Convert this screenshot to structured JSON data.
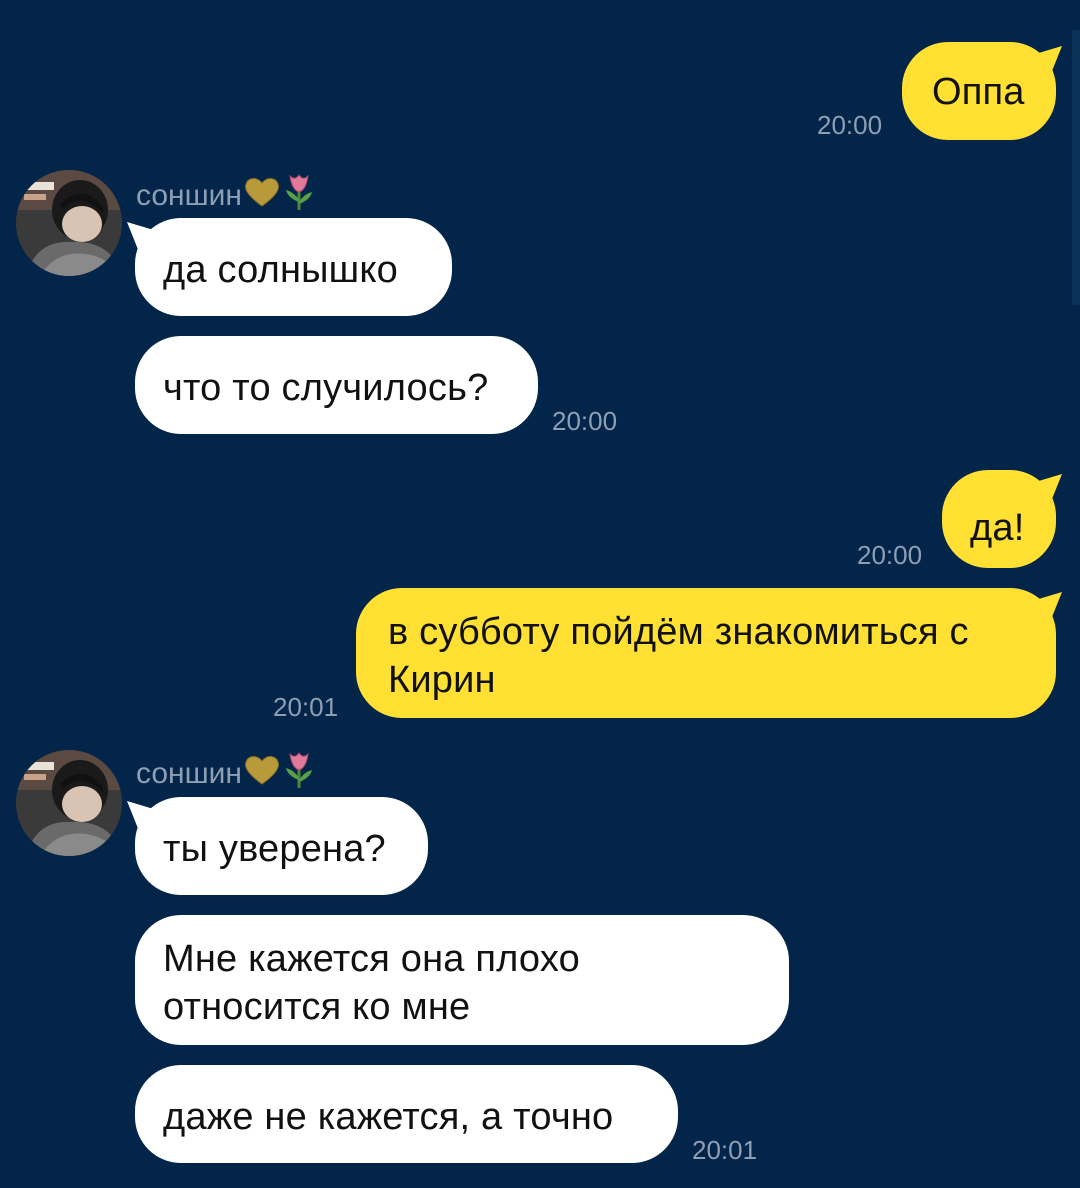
{
  "messages": [
    {
      "text": "Оппа",
      "time": "20:00"
    },
    {
      "sender": "соншин",
      "text": "да солнышко"
    },
    {
      "text": "что то случилось?",
      "time": "20:00"
    },
    {
      "text": "да!",
      "time": "20:00"
    },
    {
      "text_line1": "в субботу пойдём знакомиться с",
      "text_line2": "Кирин",
      "time": "20:01"
    },
    {
      "sender": "соншин",
      "text": "ты уверена?"
    },
    {
      "text_line1": "Мне кажется она плохо",
      "text_line2": "относится ко мне"
    },
    {
      "text": "даже не кажется, а точно",
      "time": "20:01"
    }
  ],
  "colors": {
    "background": "#022549",
    "outgoing_bubble": "#ffe033",
    "incoming_bubble": "#ffffff",
    "timestamp": "#8f9fb3"
  },
  "icons": [
    "avatar",
    "gold-heart-icon",
    "tulip-icon"
  ]
}
